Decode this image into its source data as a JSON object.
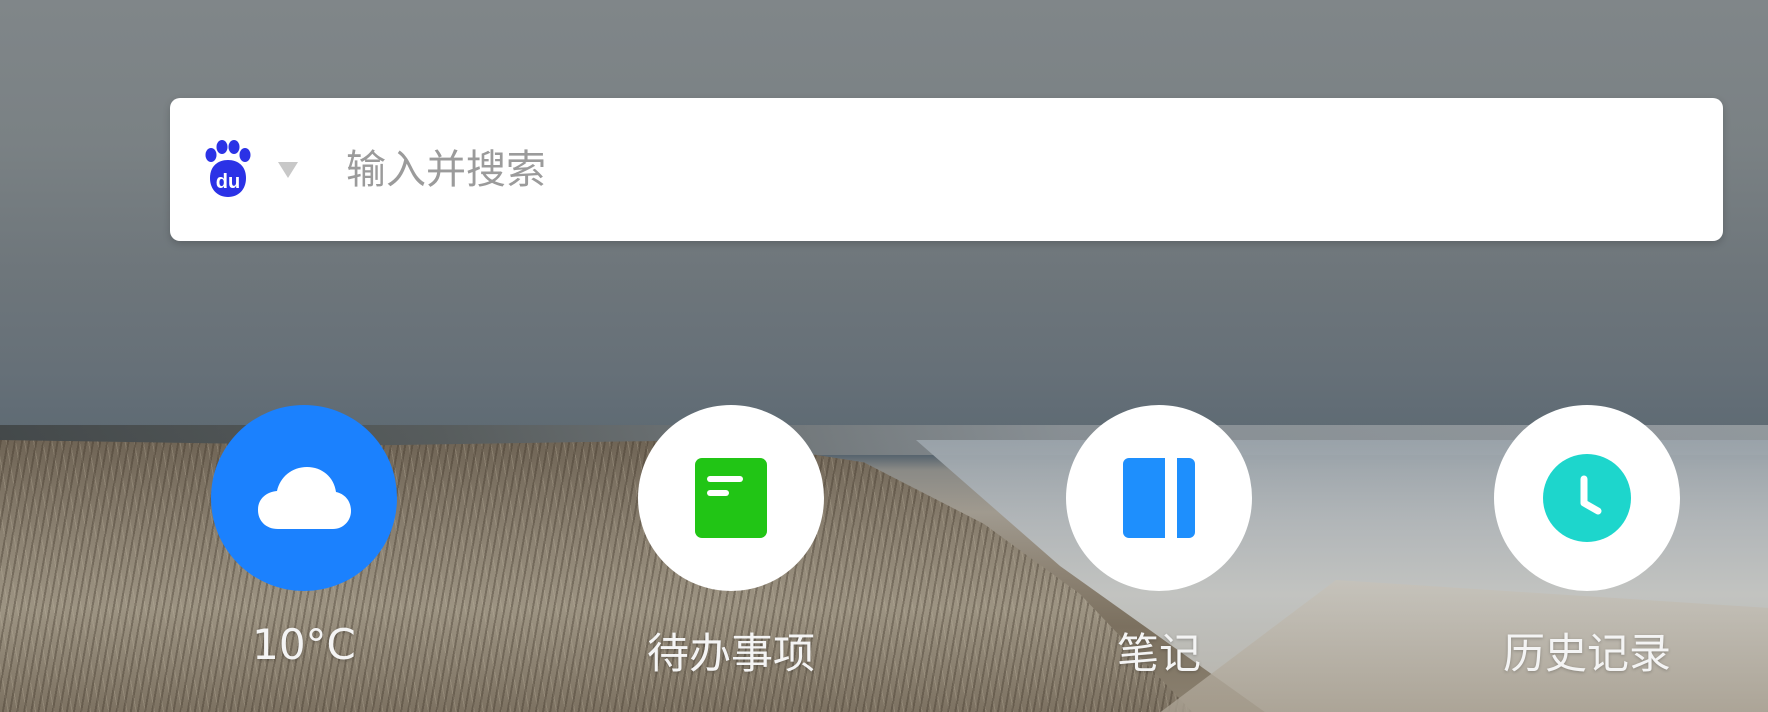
{
  "search": {
    "engine_icon": "baidu-logo",
    "engine_caret_icon": "caret-down-icon",
    "placeholder": "输入并搜索",
    "value": ""
  },
  "shortcuts": [
    {
      "label": "10°C",
      "icon": "cloud-icon",
      "color": "#1b81fe"
    },
    {
      "label": "待办事项",
      "icon": "todo-icon",
      "color": "#21c515"
    },
    {
      "label": "笔记",
      "icon": "notebook-icon",
      "color": "#1e8ffd"
    },
    {
      "label": "历史记录",
      "icon": "clock-icon",
      "color": "#1dd6cc"
    }
  ],
  "colors": {
    "baidu_blue": "#2b32e6",
    "weather_bg": "#1b81fe"
  }
}
